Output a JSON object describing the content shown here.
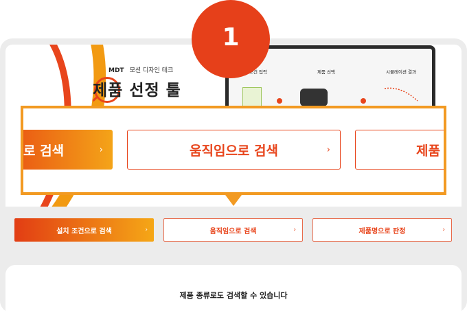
{
  "badge": {
    "number": "1"
  },
  "hero": {
    "brand": "MDT",
    "brand_sub": "모션 디자인 테크",
    "tool_title": "제품 선정 툴",
    "laptop_steps": [
      "조건 입력",
      "제품 선택",
      "시뮬레이션 결과"
    ]
  },
  "zoomed_tabs": [
    {
      "label": "로 검색",
      "state": "active"
    },
    {
      "label": "움직임으로 검색",
      "state": "inactive"
    },
    {
      "label": "제품",
      "state": "inactive"
    }
  ],
  "tabs": [
    {
      "label": "설치 조건으로 검색",
      "state": "active"
    },
    {
      "label": "움직임으로 검색",
      "state": "inactive"
    },
    {
      "label": "제품명으로 판정",
      "state": "inactive"
    }
  ],
  "chevron": "›",
  "footer_text": "제품 종류로도 검색할 수 있습니다",
  "colors": {
    "accent": "#e8451c",
    "accent_orange": "#f29a22",
    "frame": "#ececec"
  }
}
